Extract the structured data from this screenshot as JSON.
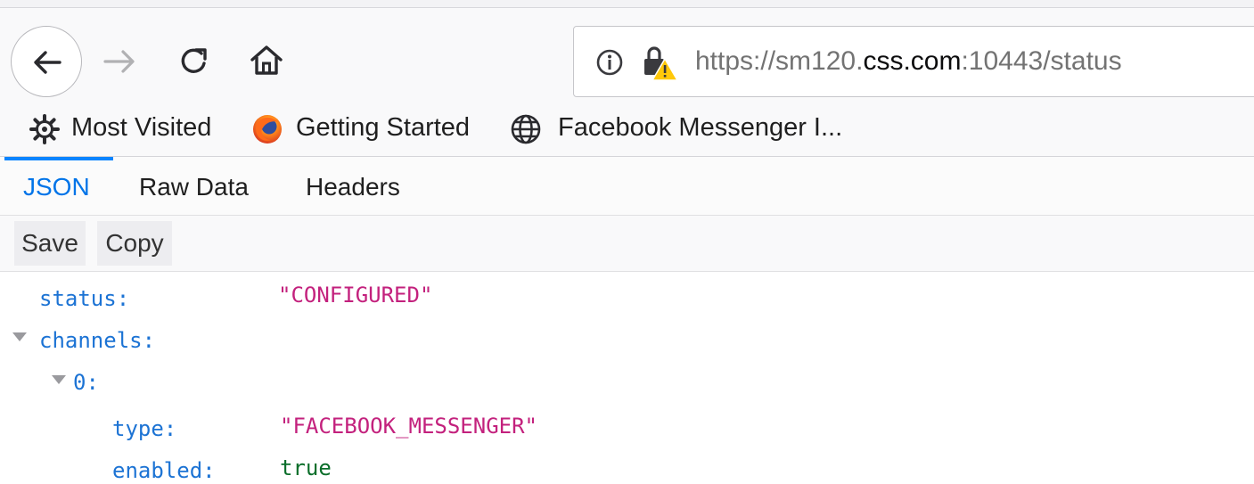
{
  "browser": {
    "url": {
      "prefix": "https://sm120.",
      "host": "css.com",
      "suffix": ":10443/status"
    },
    "bookmarks": [
      {
        "label": "Most Visited",
        "icon": "gear-icon"
      },
      {
        "label": "Getting Started",
        "icon": "firefox-icon"
      },
      {
        "label": "Facebook Messenger I...",
        "icon": "globe-icon"
      }
    ]
  },
  "viewer": {
    "tabs": [
      {
        "label": "JSON",
        "active": true
      },
      {
        "label": "Raw Data",
        "active": false
      },
      {
        "label": "Headers",
        "active": false
      }
    ],
    "toolbar": {
      "save_label": "Save",
      "copy_label": "Copy"
    }
  },
  "json": {
    "status": {
      "key": "status:",
      "value": "\"CONFIGURED\""
    },
    "channels": {
      "key": "channels:"
    },
    "item0": {
      "key": "0:"
    },
    "type": {
      "key": "type:",
      "value": "\"FACEBOOK_MESSENGER\""
    },
    "enabled": {
      "key": "enabled:",
      "value": "true"
    }
  },
  "colors": {
    "accent": "#0a84ff",
    "json_key": "#1c73d4",
    "json_string": "#c3217d",
    "json_bool": "#0b6e2a",
    "warning": "#ffc80a"
  }
}
